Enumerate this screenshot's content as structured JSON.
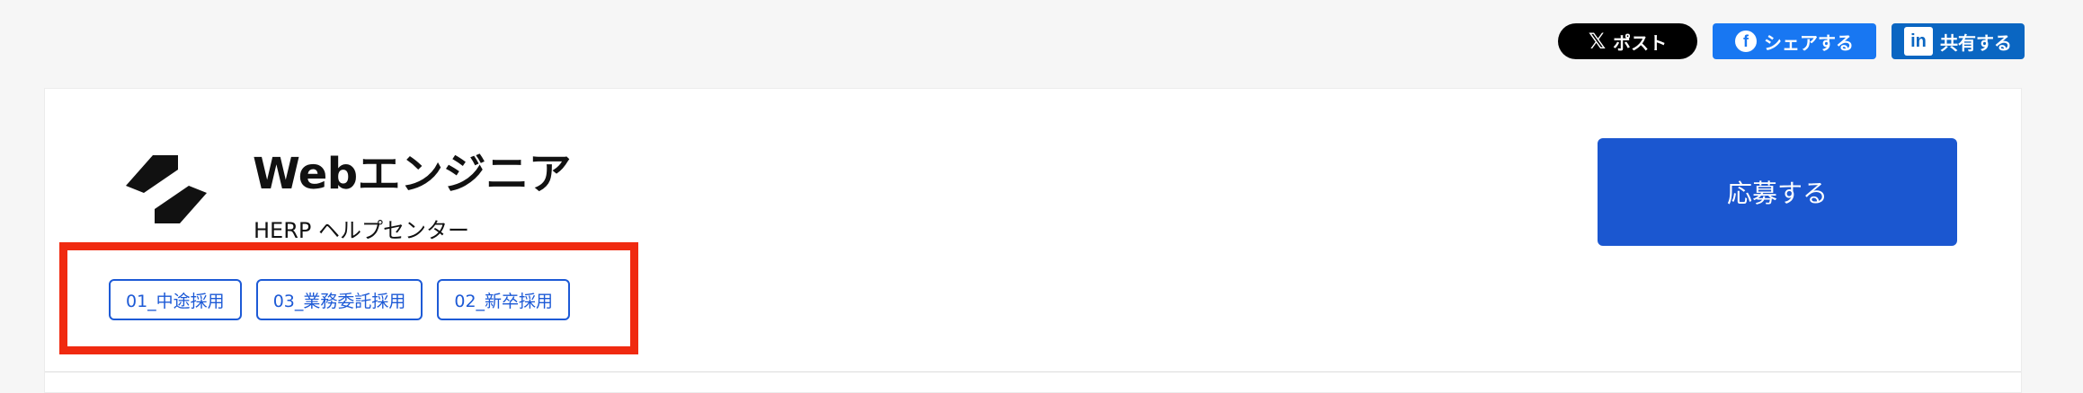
{
  "share": {
    "x_label": "ポスト",
    "x_icon": "x-logo-icon",
    "facebook_label": "シェアする",
    "facebook_icon": "facebook-icon",
    "linkedin_label": "共有する",
    "linkedin_icon": "linkedin-icon"
  },
  "job": {
    "title": "Webエンジニア",
    "company": "HERP ヘルプセンター",
    "logo_icon": "herp-logo-icon",
    "tags": [
      "01_中途採用",
      "03_業務委託採用",
      "02_新卒採用"
    ]
  },
  "apply": {
    "label": "応募する"
  },
  "colors": {
    "accent": "#1b57d0",
    "highlight": "#f02a10",
    "x": "#000000",
    "facebook": "#1877f2",
    "linkedin": "#0a66c2"
  }
}
